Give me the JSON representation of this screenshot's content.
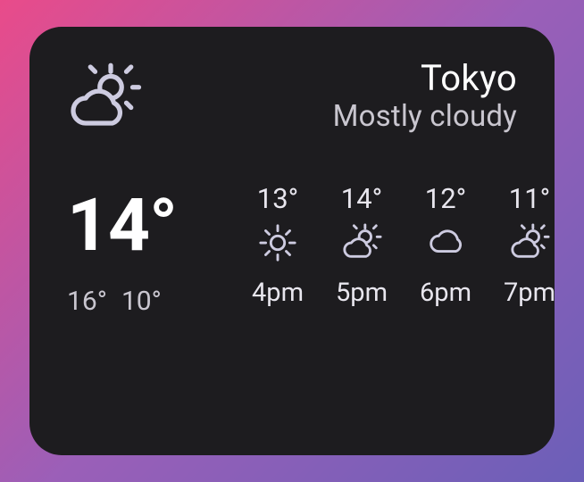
{
  "location": "Tokyo",
  "condition": "Mostly cloudy",
  "current_icon": "partly-cloudy",
  "current_temp": "14°",
  "high": "16°",
  "low": "10°",
  "forecast": [
    {
      "temp": "13°",
      "icon": "sunny",
      "time": "4pm"
    },
    {
      "temp": "14°",
      "icon": "partly-cloudy",
      "time": "5pm"
    },
    {
      "temp": "12°",
      "icon": "cloudy",
      "time": "6pm"
    },
    {
      "temp": "11°",
      "icon": "partly-cloudy",
      "time": "7pm"
    }
  ],
  "colors": {
    "widget_bg": "#1d1c1f",
    "text_primary": "#ffffff",
    "text_secondary": "#c9c6cf",
    "icon_stroke": "#cdcbe0"
  }
}
